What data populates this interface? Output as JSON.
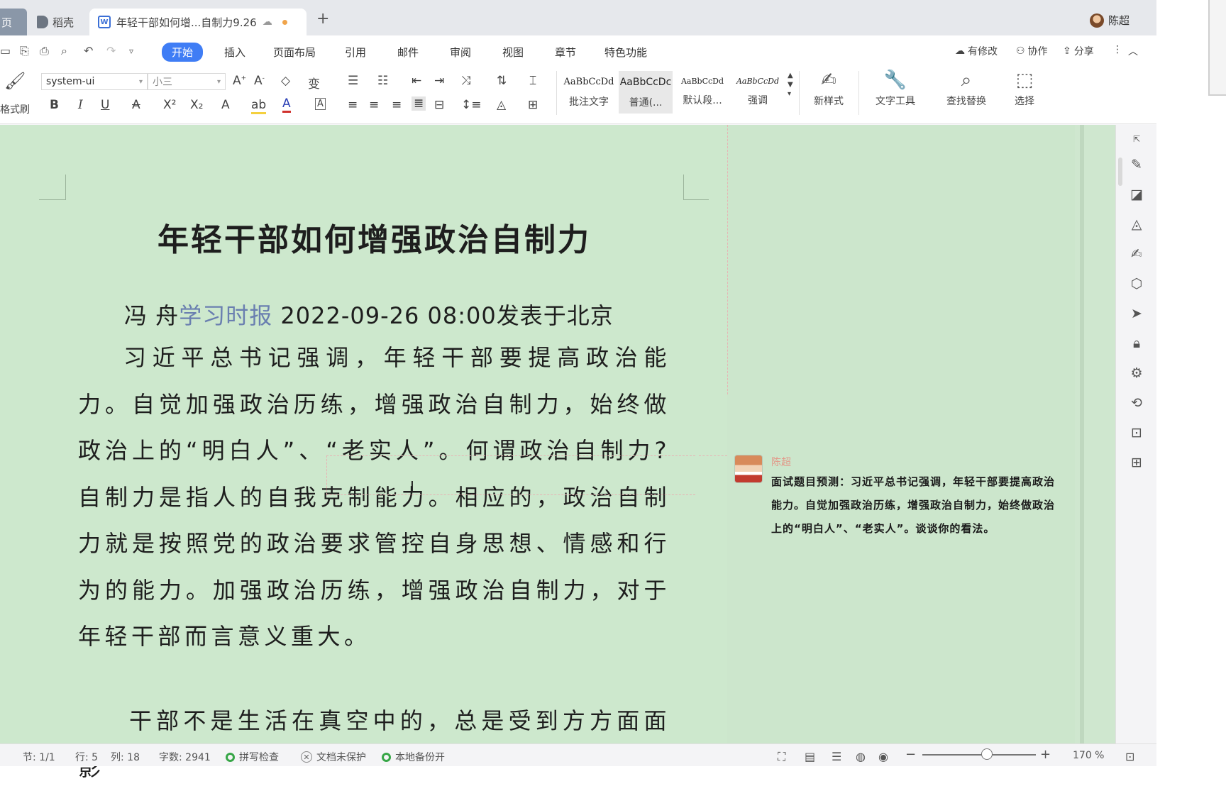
{
  "tabs": {
    "home": "页",
    "daoke": "稻壳",
    "doc_title": "年轻干部如何增...自制力9.26",
    "new_tab": "+"
  },
  "user": {
    "name": "陈超"
  },
  "menu": {
    "items": [
      "开始",
      "插入",
      "页面布局",
      "引用",
      "邮件",
      "审阅",
      "视图",
      "章节",
      "特色功能"
    ],
    "active": "开始",
    "modified": "有修改",
    "collab": "协作",
    "share": "分享"
  },
  "ribbon": {
    "format_painter": "格式刷",
    "font_name": "system-ui",
    "font_size": "小三",
    "styles": [
      {
        "sample": "AaBbCcDd",
        "name": "批注文字"
      },
      {
        "sample": "AaBbCcDc",
        "name": "普通(..."
      },
      {
        "sample": "AaBbCcDd",
        "name": "默认段..."
      },
      {
        "sample": "AaBbCcDd",
        "name": "强调"
      }
    ],
    "new_style": "新样式",
    "text_tools": "文字工具",
    "find_replace": "查找替换",
    "select": "选择"
  },
  "document": {
    "title": "年轻干部如何增强政治自制力",
    "byline_author": "冯  舟",
    "byline_source": "学习时报",
    "byline_rest": " 2022-09-26 08:00发表于北京",
    "para1": "习近平总书记强调，年轻干部要提高政治能力。自觉加强政治历练，增强政治自制力，始终做政治上的“明白人”、“老实人”。何谓政治自制力?自制力是指人的自我克制能力。相应的，政治自制力就是按照党的政治要求管控自身思想、情感和行为的能力。加强政治历练，增强政治自制力，对于年轻干部而言意义重大。",
    "para2": "干部不是生活在真空中的，总是受到方方面面影"
  },
  "comment": {
    "author": "陈超",
    "text": "面试题目预测：习近平总书记强调，年轻干部要提高政治能力。自觉加强政治历练，增强政治自制力，始终做政治上的“明白人”、“老实人”。谈谈你的看法。"
  },
  "status": {
    "section": "节: 1/1",
    "row": "行: 5",
    "col": "列: 18",
    "word_count": "字数: 2941",
    "spell_check": "拼写检查",
    "doc_protect": "文档未保护",
    "backup": "本地备份开",
    "zoom": "170 %"
  },
  "colors": {
    "accent": "#3f7df5",
    "doc_bg": "#cde8cd",
    "source_link": "#6a7fb0",
    "status_ok": "#37a647"
  }
}
